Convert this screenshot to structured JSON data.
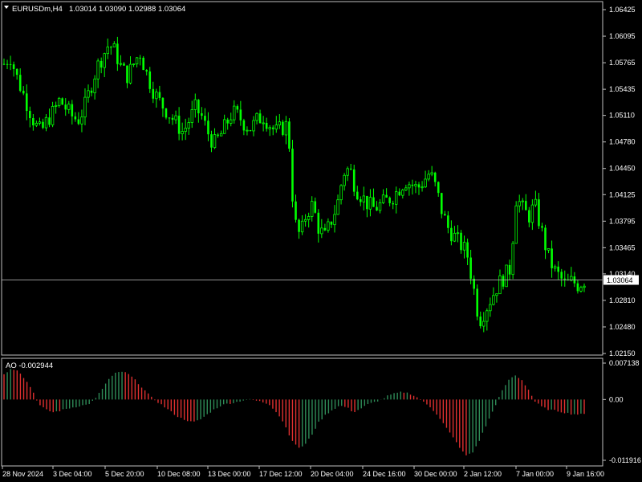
{
  "header": {
    "symbol": "EURUSDm,H4",
    "ohlc": "1.03014 1.03090 1.02988 1.03064"
  },
  "price_axis": {
    "labels": [
      "1.06425",
      "1.06095",
      "1.05765",
      "1.05435",
      "1.05110",
      "1.04780",
      "1.04450",
      "1.04125",
      "1.03795",
      "1.03465",
      "1.03140",
      "1.02810",
      "1.02480",
      "1.02150"
    ],
    "current_price": "1.03064"
  },
  "indicator": {
    "title": "AO -0.002944",
    "labels": [
      "0.007138",
      "0.00",
      "-0.011916"
    ]
  },
  "time_axis": {
    "labels": [
      "28 Nov 2024",
      "3 Dec 04:00",
      "5 Dec 20:00",
      "10 Dec 08:00",
      "13 Dec 00:00",
      "17 Dec 12:00",
      "20 Dec 04:00",
      "24 Dec 16:00",
      "30 Dec 00:00",
      "2 Jan 12:00",
      "7 Jan 00:00",
      "9 Jan 16:00"
    ]
  },
  "colors": {
    "background": "#000000",
    "candle": "#00ff00",
    "grid_line": "#c0c0c0",
    "ao_up": "#2e8b57",
    "ao_down": "#e03030"
  },
  "chart_data": {
    "type": "candlestick",
    "symbol": "EURUSDm",
    "timeframe": "H4",
    "ylim": [
      1.0215,
      1.0647
    ],
    "close_path": [
      1.0575,
      1.0585,
      1.056,
      1.054,
      1.052,
      1.05,
      1.049,
      1.0505,
      1.0515,
      1.053,
      1.052,
      1.051,
      1.0505,
      1.052,
      1.0545,
      1.057,
      1.0585,
      1.06,
      1.059,
      1.057,
      1.056,
      1.0575,
      1.059,
      1.0565,
      1.0545,
      1.053,
      1.052,
      1.051,
      1.05,
      1.049,
      1.0505,
      1.052,
      1.051,
      1.049,
      1.0475,
      1.0485,
      1.05,
      1.0515,
      1.051,
      1.05,
      1.0495,
      1.0505,
      1.051,
      1.05,
      1.049,
      1.0495,
      1.05,
      1.038,
      1.036,
      1.039,
      1.04,
      1.037,
      1.036,
      1.038,
      1.04,
      1.044,
      1.0445,
      1.042,
      1.041,
      1.04,
      1.0395,
      1.04,
      1.0405,
      1.041,
      1.042,
      1.043,
      1.0425,
      1.042,
      1.043,
      1.044,
      1.042,
      1.039,
      1.037,
      1.036,
      1.035,
      1.034,
      1.03,
      1.0255,
      1.027,
      1.0285,
      1.03,
      1.031,
      1.032,
      1.041,
      1.0395,
      1.0385,
      1.04,
      1.037,
      1.034,
      1.032,
      1.031,
      1.03,
      1.0305,
      1.03,
      1.0306
    ],
    "current_price": 1.03064,
    "time_labels": [
      "28 Nov 2024",
      "3 Dec 04:00",
      "5 Dec 20:00",
      "10 Dec 08:00",
      "13 Dec 00:00",
      "17 Dec 12:00",
      "20 Dec 04:00",
      "24 Dec 16:00",
      "30 Dec 00:00",
      "2 Jan 12:00",
      "7 Jan 00:00",
      "9 Jan 16:00"
    ],
    "price_ticks": [
      1.06425,
      1.06095,
      1.05765,
      1.05435,
      1.0511,
      1.0478,
      1.0445,
      1.04125,
      1.03795,
      1.03465,
      1.0314,
      1.0281,
      1.0248,
      1.0215
    ],
    "ao": {
      "name": "AO",
      "current": -0.002944,
      "ylim": [
        -0.011916,
        0.007138
      ],
      "ticks": [
        0.007138,
        0.0,
        -0.011916
      ],
      "values": [
        0.005,
        0.006,
        0.0058,
        0.004,
        0.002,
        -0.001,
        -0.002,
        -0.0025,
        -0.0022,
        -0.0018,
        -0.0015,
        -0.0012,
        -0.001,
        0.0,
        0.002,
        0.004,
        0.0052,
        0.0055,
        0.0048,
        0.0035,
        0.002,
        0.0005,
        -0.0005,
        -0.0015,
        -0.0025,
        -0.0035,
        -0.004,
        -0.0045,
        -0.004,
        -0.003,
        -0.002,
        -0.0012,
        -0.0008,
        -0.0006,
        -0.0002,
        0.0,
        -0.0002,
        -0.0005,
        -0.001,
        -0.0025,
        -0.0045,
        -0.0075,
        -0.0095,
        -0.009,
        -0.007,
        -0.0045,
        -0.003,
        -0.002,
        -0.0012,
        -0.0015,
        -0.0025,
        -0.0018,
        -0.001,
        -0.0005,
        0.0,
        0.0008,
        0.0012,
        0.0015,
        0.0012,
        0.0005,
        -0.0005,
        -0.0015,
        -0.003,
        -0.005,
        -0.007,
        -0.009,
        -0.011,
        -0.0105,
        -0.008,
        -0.005,
        -0.002,
        0.001,
        0.0035,
        0.0048,
        0.004,
        0.002,
        -0.0005,
        -0.0015,
        -0.002,
        -0.0022,
        -0.0025,
        -0.0028,
        -0.0029,
        -0.0029
      ]
    }
  }
}
